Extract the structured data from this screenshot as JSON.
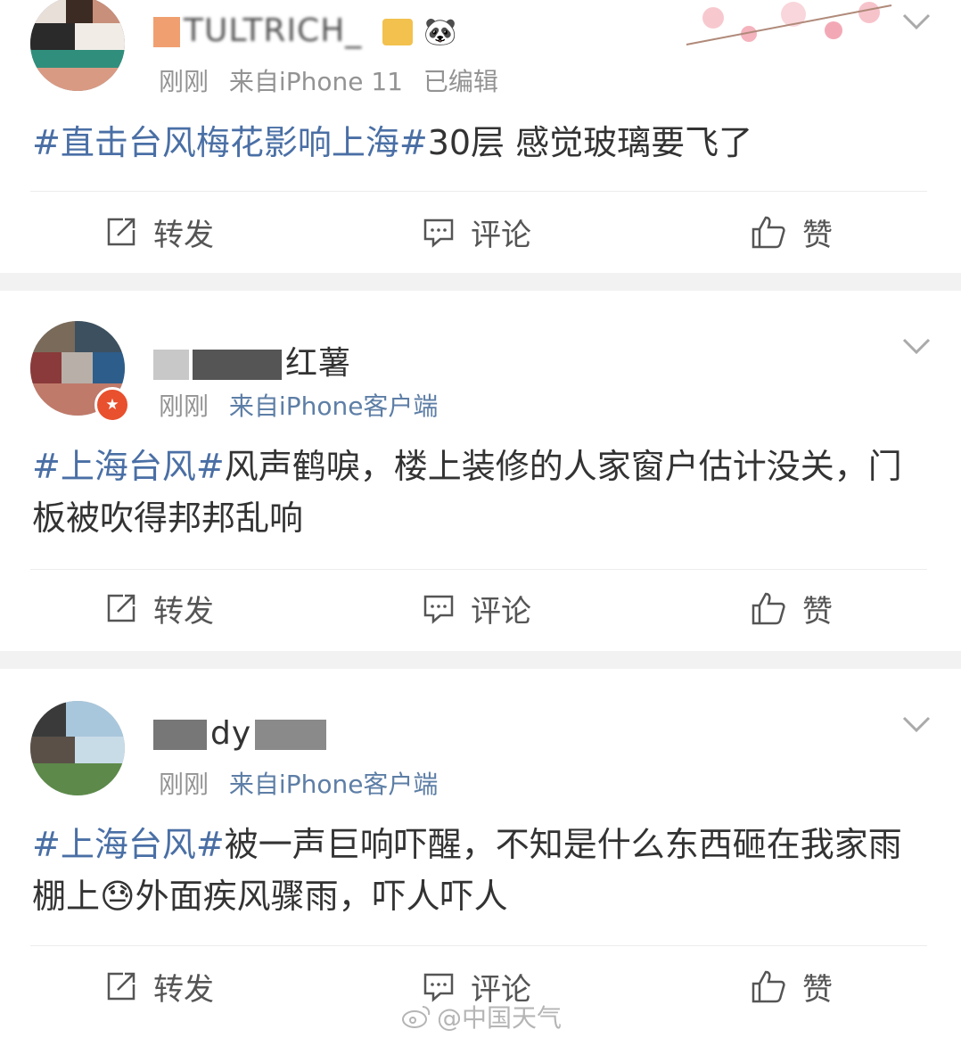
{
  "posts": [
    {
      "username_visible": "TULTRICH_",
      "time": "刚刚",
      "source": "来自iPhone 11",
      "edited": "已编辑",
      "topic": "#直击台风梅花影响上海#",
      "text": "30层 感觉玻璃要飞了"
    },
    {
      "username_visible": "红薯",
      "time": "刚刚",
      "source": "来自iPhone客户端",
      "topic": "#上海台风#",
      "text": "风声鹤唳，楼上装修的人家窗户估计没关，门板被吹得邦邦乱响"
    },
    {
      "username_visible": "dy",
      "time": "刚刚",
      "source": "来自iPhone客户端",
      "topic": "#上海台风#",
      "text_before_emoji": "被一声巨响吓醒，不知是什么东西砸在我家雨棚上",
      "emoji": "😓",
      "text_after_emoji": "外面疾风骤雨，吓人吓人"
    }
  ],
  "actions": {
    "repost": "转发",
    "comment": "评论",
    "like": "赞"
  },
  "watermark": "@中国天气",
  "colors": {
    "topic": "#4a6fa5",
    "meta": "#939393",
    "source_link": "#5d7ea6",
    "separator": "#f2f2f2"
  }
}
